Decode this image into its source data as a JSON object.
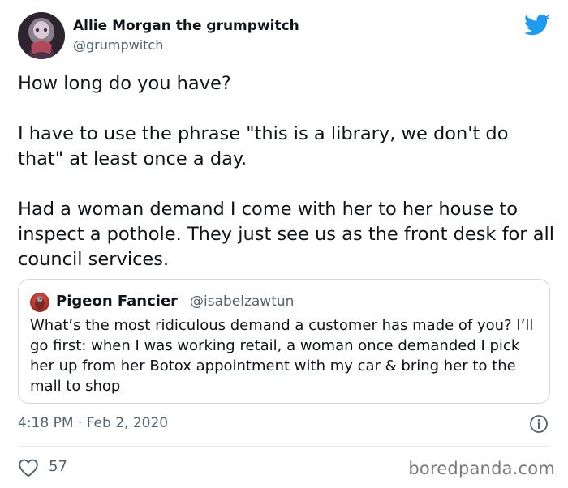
{
  "user": {
    "name": "Allie Morgan the grumpwitch",
    "handle": "@grumpwitch",
    "avatar_icon": "profile-photo"
  },
  "brand": {
    "logo_icon": "twitter-bird-icon",
    "color": "#1d9bf0"
  },
  "tweet": {
    "paragraphs": [
      "How long do you have?",
      "I have to use the phrase \"this is a library, we don't do that\" at least once a day.",
      "Had a woman demand I come with her to her house to inspect a pothole. They just see us as the front desk for all council services."
    ],
    "timestamp": "4:18 PM · Feb 2, 2020"
  },
  "quote": {
    "name": "Pigeon Fancier",
    "handle": "@isabelzawtun",
    "text": "What’s the most ridiculous demand a customer has made of you? I’ll go first: when I was working retail, a woman once demanded I pick her up from her Botox appointment with my car & bring her to the mall to shop"
  },
  "actions": {
    "like_icon": "heart-icon",
    "like_count": "57",
    "info_icon": "info-icon"
  },
  "watermark": "boredpanda.com",
  "colors": {
    "text": "#0f1419",
    "secondary": "#536471",
    "border": "#cfd9de"
  }
}
